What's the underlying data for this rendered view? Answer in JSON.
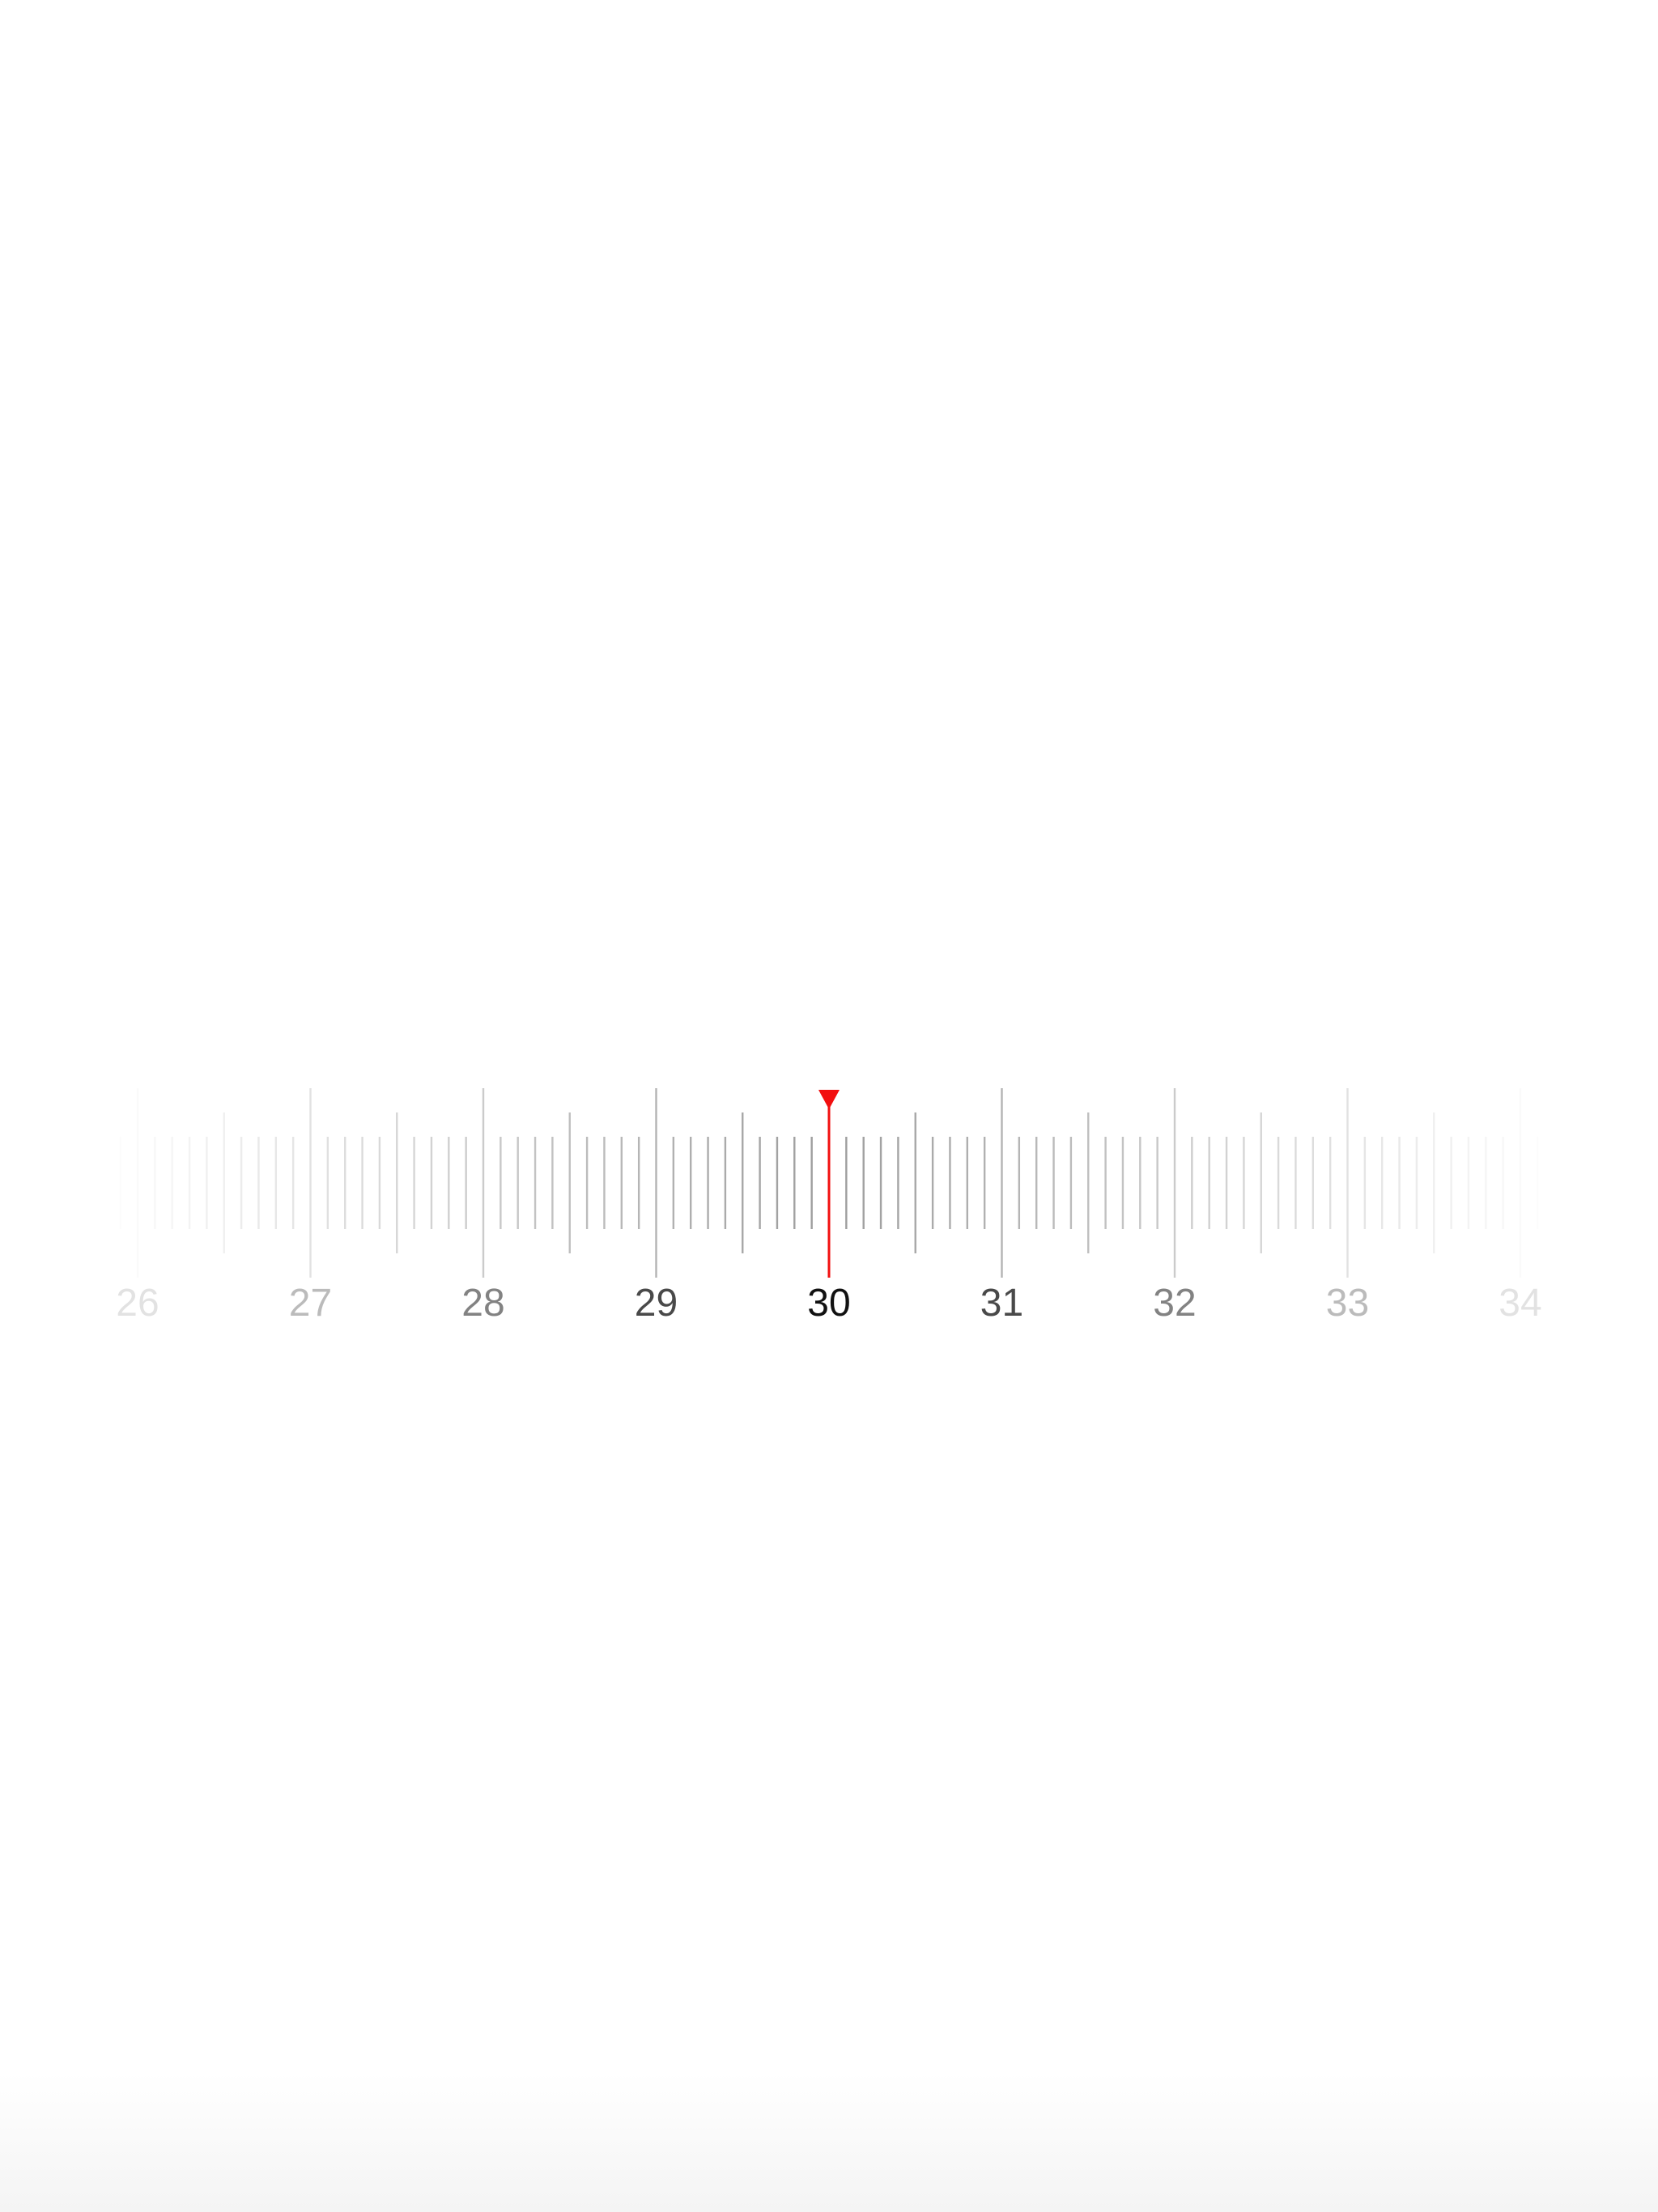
{
  "ruler": {
    "selected_value": 30,
    "min_visible": 25.5,
    "max_visible": 34.5,
    "minor_step": 0.1,
    "labels": [
      "26",
      "27",
      "28",
      "29",
      "30",
      "31",
      "32",
      "33",
      "34"
    ],
    "indicator_color": "#f20f0f",
    "tick_color": "#222222",
    "label_color": "#111111"
  }
}
